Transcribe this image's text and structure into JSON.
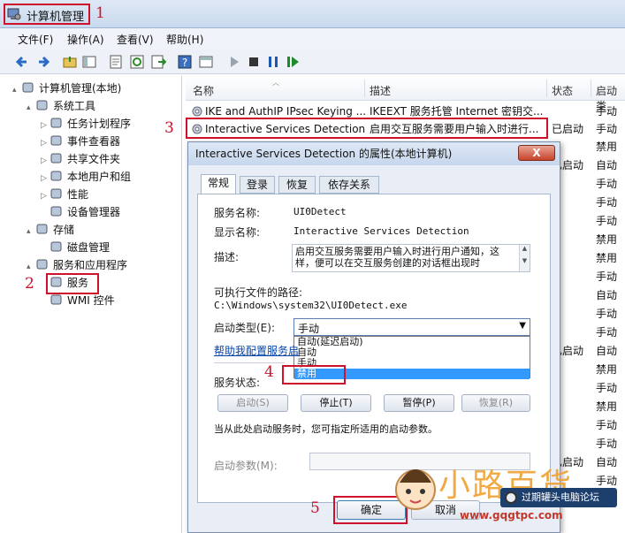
{
  "window": {
    "title": "计算机管理"
  },
  "menu": {
    "items": [
      "文件(F)",
      "操作(A)",
      "查看(V)",
      "帮助(H)"
    ]
  },
  "tree": [
    {
      "label": "计算机管理(本地)",
      "icon": "computer-icon",
      "indent": 0,
      "expand": "▴"
    },
    {
      "label": "系统工具",
      "icon": "tools-icon",
      "indent": 1,
      "expand": "▴"
    },
    {
      "label": "任务计划程序",
      "icon": "clock-icon",
      "indent": 2,
      "expand": "▷"
    },
    {
      "label": "事件查看器",
      "icon": "event-viewer-icon",
      "indent": 2,
      "expand": "▷"
    },
    {
      "label": "共享文件夹",
      "icon": "shared-folder-icon",
      "indent": 2,
      "expand": "▷"
    },
    {
      "label": "本地用户和组",
      "icon": "users-icon",
      "indent": 2,
      "expand": "▷"
    },
    {
      "label": "性能",
      "icon": "performance-icon",
      "indent": 2,
      "expand": "▷"
    },
    {
      "label": "设备管理器",
      "icon": "device-manager-icon",
      "indent": 2,
      "expand": ""
    },
    {
      "label": "存储",
      "icon": "storage-icon",
      "indent": 1,
      "expand": "▴"
    },
    {
      "label": "磁盘管理",
      "icon": "disk-icon",
      "indent": 2,
      "expand": ""
    },
    {
      "label": "服务和应用程序",
      "icon": "services-apps-icon",
      "indent": 1,
      "expand": "▴"
    },
    {
      "label": "服务",
      "icon": "services-gear-icon",
      "indent": 2,
      "expand": ""
    },
    {
      "label": "WMI 控件",
      "icon": "wmi-icon",
      "indent": 2,
      "expand": ""
    }
  ],
  "list": {
    "headers": {
      "name": "名称",
      "desc": "描述",
      "status": "状态",
      "startup": "启动类"
    },
    "rows": [
      {
        "name": "IKE and AuthIP IPsec Keying ...",
        "desc": "IKEEXT 服务托管 Internet 密钥交...",
        "status": "",
        "startup": "手动"
      },
      {
        "name": "Interactive Services Detection",
        "desc": "启用交互服务需要用户输入时进行...",
        "status": "已启动",
        "startup": "手动"
      }
    ],
    "right_col": [
      {
        "status": "",
        "startup": "禁用"
      },
      {
        "status": "已启动",
        "startup": "自动"
      },
      {
        "status": "",
        "startup": "手动"
      },
      {
        "status": "",
        "startup": "手动"
      },
      {
        "status": "",
        "startup": "手动"
      },
      {
        "status": "",
        "startup": "禁用"
      },
      {
        "status": "",
        "startup": "禁用"
      },
      {
        "status": "",
        "startup": "手动"
      },
      {
        "status": "",
        "startup": "自动"
      },
      {
        "status": "",
        "startup": "手动"
      },
      {
        "status": "",
        "startup": "手动"
      },
      {
        "status": "已启动",
        "startup": "自动"
      },
      {
        "status": "",
        "startup": "禁用"
      },
      {
        "status": "",
        "startup": "手动"
      },
      {
        "status": "",
        "startup": "禁用"
      },
      {
        "status": "",
        "startup": "手动"
      },
      {
        "status": "",
        "startup": "手动"
      },
      {
        "status": "已启动",
        "startup": "自动"
      },
      {
        "status": "",
        "startup": "手动"
      },
      {
        "status": "",
        "startup": "手动"
      }
    ]
  },
  "dialog": {
    "title": "Interactive Services Detection 的属性(本地计算机)",
    "close": "X",
    "tabs": [
      "常规",
      "登录",
      "恢复",
      "依存关系"
    ],
    "service_name_label": "服务名称:",
    "service_name": "UI0Detect",
    "display_name_label": "显示名称:",
    "display_name": "Interactive Services Detection",
    "desc_label": "描述:",
    "desc_text": "启用交互服务需要用户输入时进行用户通知，这样，便可以在交互服务创建的对话框出现时",
    "exe_label": "可执行文件的路径:",
    "exe_path": "C:\\Windows\\system32\\UI0Detect.exe",
    "startup_label": "启动类型(E):",
    "startup_value": "手动",
    "options": [
      "自动(延迟启动)",
      "自动",
      "手动",
      "禁用"
    ],
    "help_link": "帮助我配置服务启",
    "status_label": "服务状态:",
    "buttons": {
      "start": "启动(S)",
      "stop": "停止(T)",
      "pause": "暂停(P)",
      "resume": "恢复(R)"
    },
    "hint": "当从此处启动服务时，您可指定所适用的启动参数。",
    "params_label": "启动参数(M):",
    "ok": "确定",
    "cancel": "取消"
  },
  "annotations": [
    "1",
    "2",
    "3",
    "4",
    "5"
  ],
  "watermark": {
    "text": "小路百货",
    "site": "www.gqgtpc.com",
    "badge": "过期罐头电脑论坛"
  }
}
